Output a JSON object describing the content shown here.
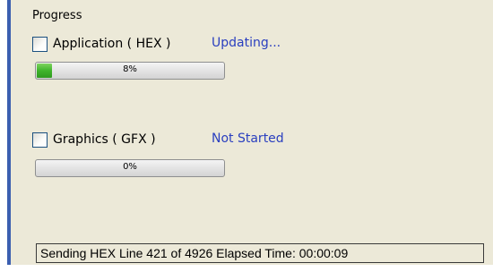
{
  "group": {
    "title": "Progress"
  },
  "items": [
    {
      "label": "Application ( HEX )",
      "status": "Updating...",
      "progress_text": "8%",
      "progress_fraction": 0.08,
      "checked": false
    },
    {
      "label": "Graphics ( GFX )",
      "status": "Not Started",
      "progress_text": "0%",
      "progress_fraction": 0,
      "checked": false
    }
  ],
  "statusbar": {
    "text": "Sending HEX Line 421 of 4926  Elapsed Time: 00:00:09"
  },
  "colors": {
    "status_text": "#2a3fbf",
    "progress_fill": "#3fb42b",
    "panel_background": "#ece9d8",
    "accent_border": "#3b5fb0"
  }
}
